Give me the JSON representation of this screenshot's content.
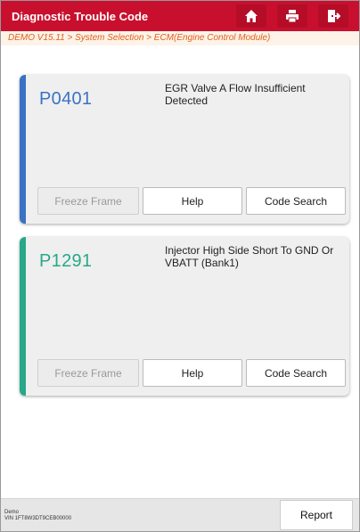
{
  "header": {
    "title": "Diagnostic Trouble Code",
    "accent_color": "#c8102e",
    "icons": [
      "home-icon",
      "print-icon",
      "exit-icon"
    ]
  },
  "breadcrumb": "DEMO V15.11 > System Selection > ECM(Engine Control Module)",
  "codes": [
    {
      "code": "P0401",
      "description": "EGR Valve A Flow Insufficient Detected",
      "color": "#3a72c4",
      "freeze_frame_label": "Freeze Frame",
      "help_label": "Help",
      "code_search_label": "Code Search"
    },
    {
      "code": "P1291",
      "description": "Injector High Side Short To GND Or VBATT (Bank1)",
      "color": "#27a889",
      "freeze_frame_label": "Freeze Frame",
      "help_label": "Help",
      "code_search_label": "Code Search"
    }
  ],
  "footer": {
    "mode": "Demo",
    "vin": "VIN 1FT8W3DT9CEB00000",
    "report_label": "Report"
  }
}
